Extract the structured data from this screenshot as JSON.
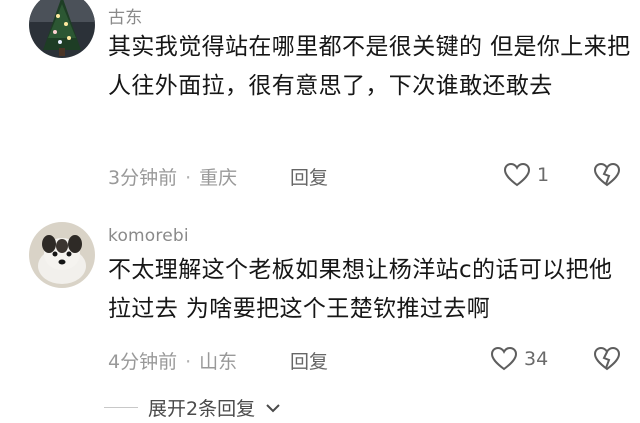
{
  "comments": [
    {
      "username": "古东",
      "text": "其实我觉得站在哪里都不是很关键的 但是你上来把人往外面拉，很有意思了，下次谁敢还敢去",
      "time": "3分钟前",
      "location": "重庆",
      "reply_label": "回复",
      "likes": "1",
      "avatar_icon": "christmas-tree-avatar"
    },
    {
      "username": "komorebi",
      "text": "不太理解这个老板如果想让杨洋站c的话可以把他拉过去 为啥要把这个王楚钦推过去啊",
      "time": "4分钟前",
      "location": "山东",
      "reply_label": "回复",
      "likes": "34",
      "avatar_icon": "dog-avatar"
    }
  ],
  "expand_replies": {
    "label": "展开2条回复",
    "icon": "chevron-down-icon"
  },
  "colors": {
    "text": "#161616",
    "meta": "#999999",
    "username": "#8a8a8a"
  }
}
